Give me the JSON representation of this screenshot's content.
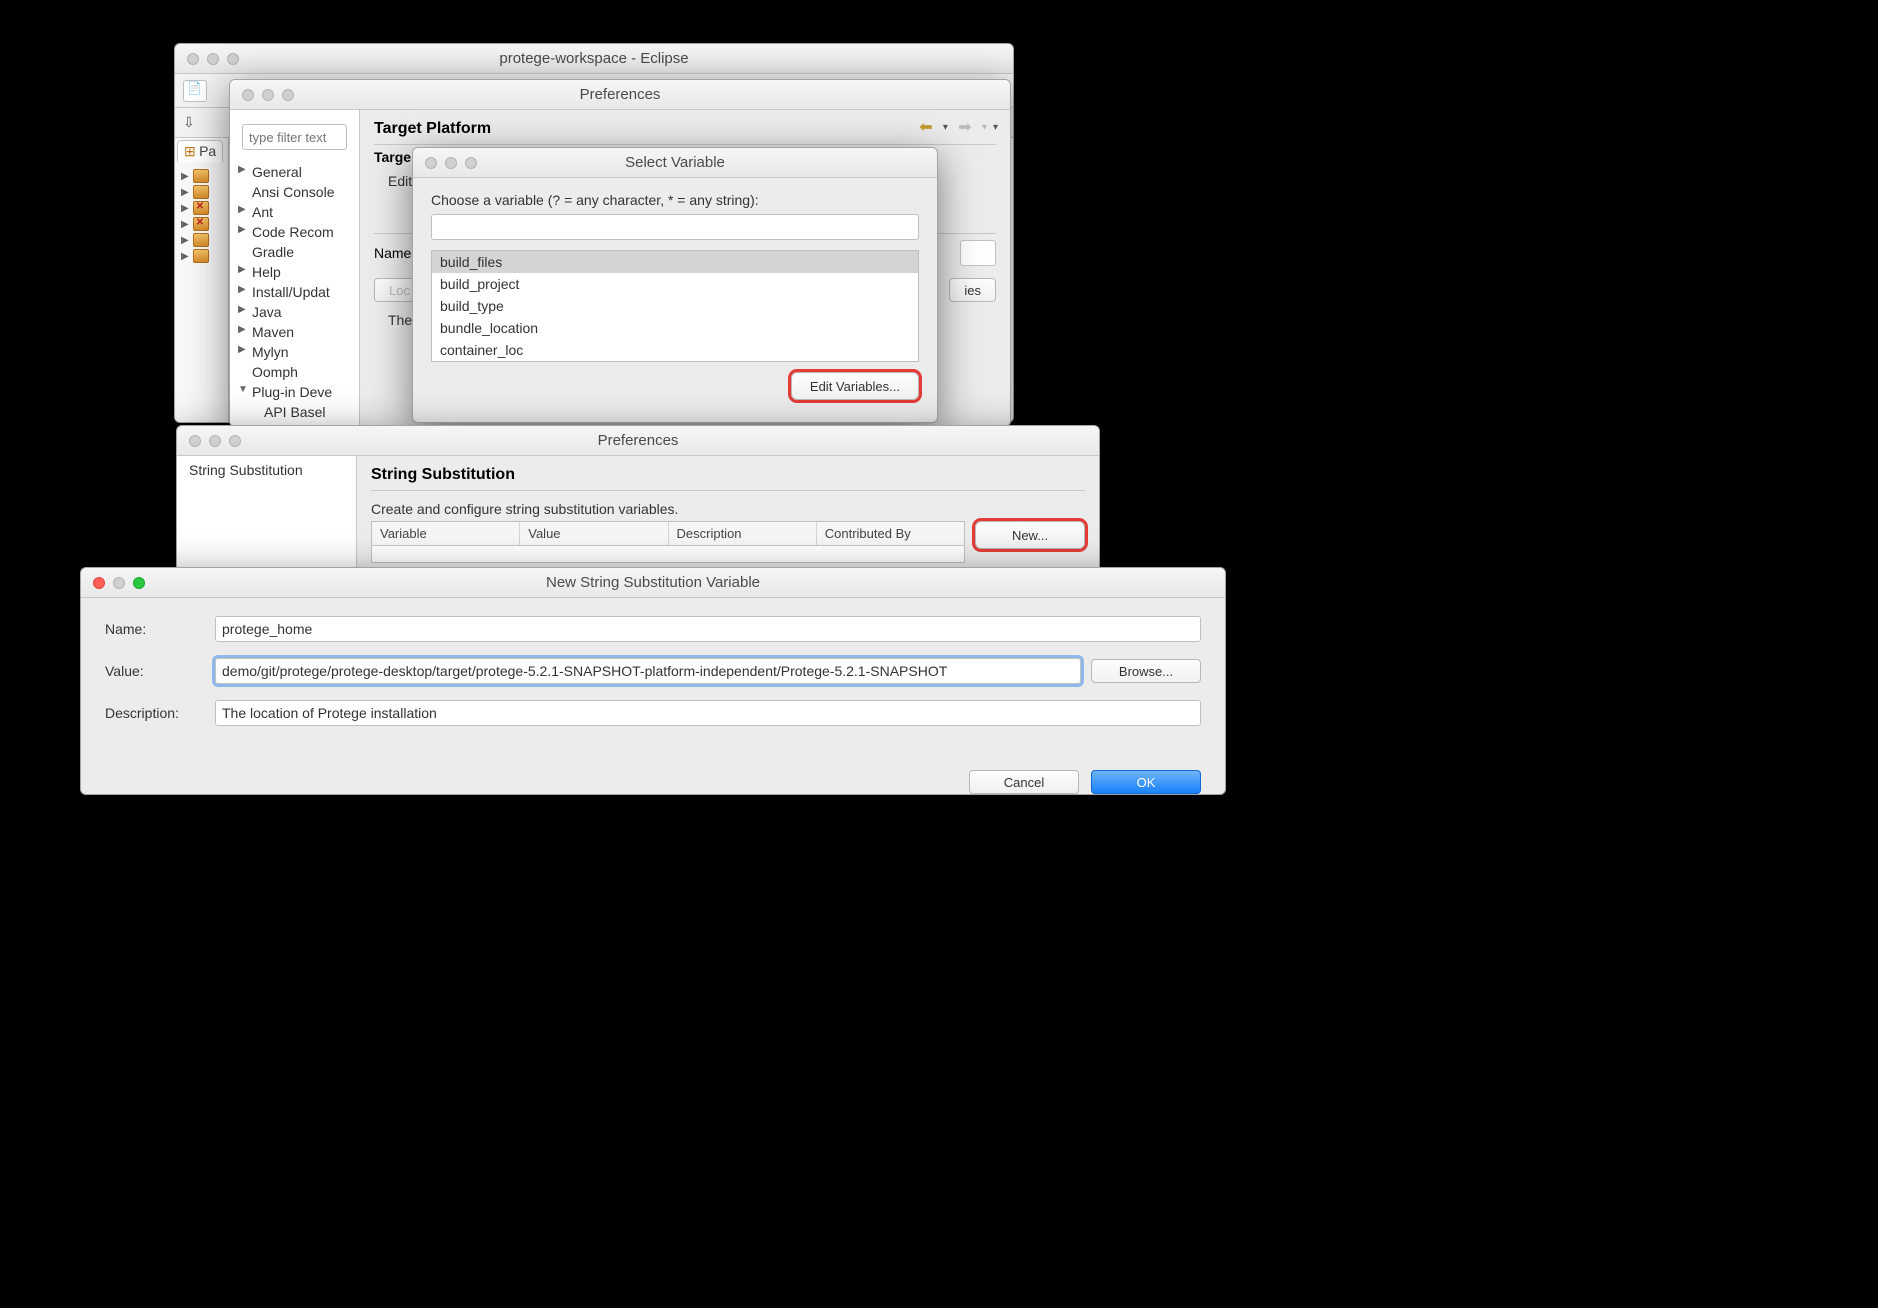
{
  "eclipse": {
    "title": "protege-workspace - Eclipse",
    "package_tab": "Pa",
    "packages": [
      "",
      "",
      "",
      "",
      "",
      ""
    ]
  },
  "prefs1": {
    "title": "Preferences",
    "filter_placeholder": "type filter text",
    "tree": [
      "General",
      "Ansi Console",
      "Ant",
      "Code Recom",
      "Gradle",
      "Help",
      "Install/Updat",
      "Java",
      "Maven",
      "Mylyn",
      "Oomph",
      "Plug-in Deve",
      "API Basel"
    ],
    "page_title": "Target Platform",
    "section": "Targe",
    "sub": "Edit t",
    "name_label": "Name:",
    "loc_btn": "Loc",
    "the_text": "The",
    "ies_btn": "ies"
  },
  "selvar": {
    "title": "Select Variable",
    "prompt": "Choose a variable (? = any character, * = any string):",
    "items": [
      "build_files",
      "build_project",
      "build_type",
      "bundle_location",
      "container_loc"
    ],
    "edit_btn": "Edit Variables..."
  },
  "prefs2": {
    "title": "Preferences",
    "sidebar": "String Substitution",
    "page_title": "String Substitution",
    "desc": "Create and configure string substitution variables.",
    "cols": [
      "Variable",
      "Value",
      "Description",
      "Contributed By"
    ],
    "new_btn": "New..."
  },
  "newvar": {
    "title": "New String Substitution Variable",
    "name_label": "Name:",
    "name_value": "protege_home",
    "value_label": "Value:",
    "value_value": "demo/git/protege/protege-desktop/target/protege-5.2.1-SNAPSHOT-platform-independent/Protege-5.2.1-SNAPSHOT",
    "browse_btn": "Browse...",
    "desc_label": "Description:",
    "desc_value": "The location of Protege installation",
    "cancel": "Cancel",
    "ok": "OK"
  }
}
